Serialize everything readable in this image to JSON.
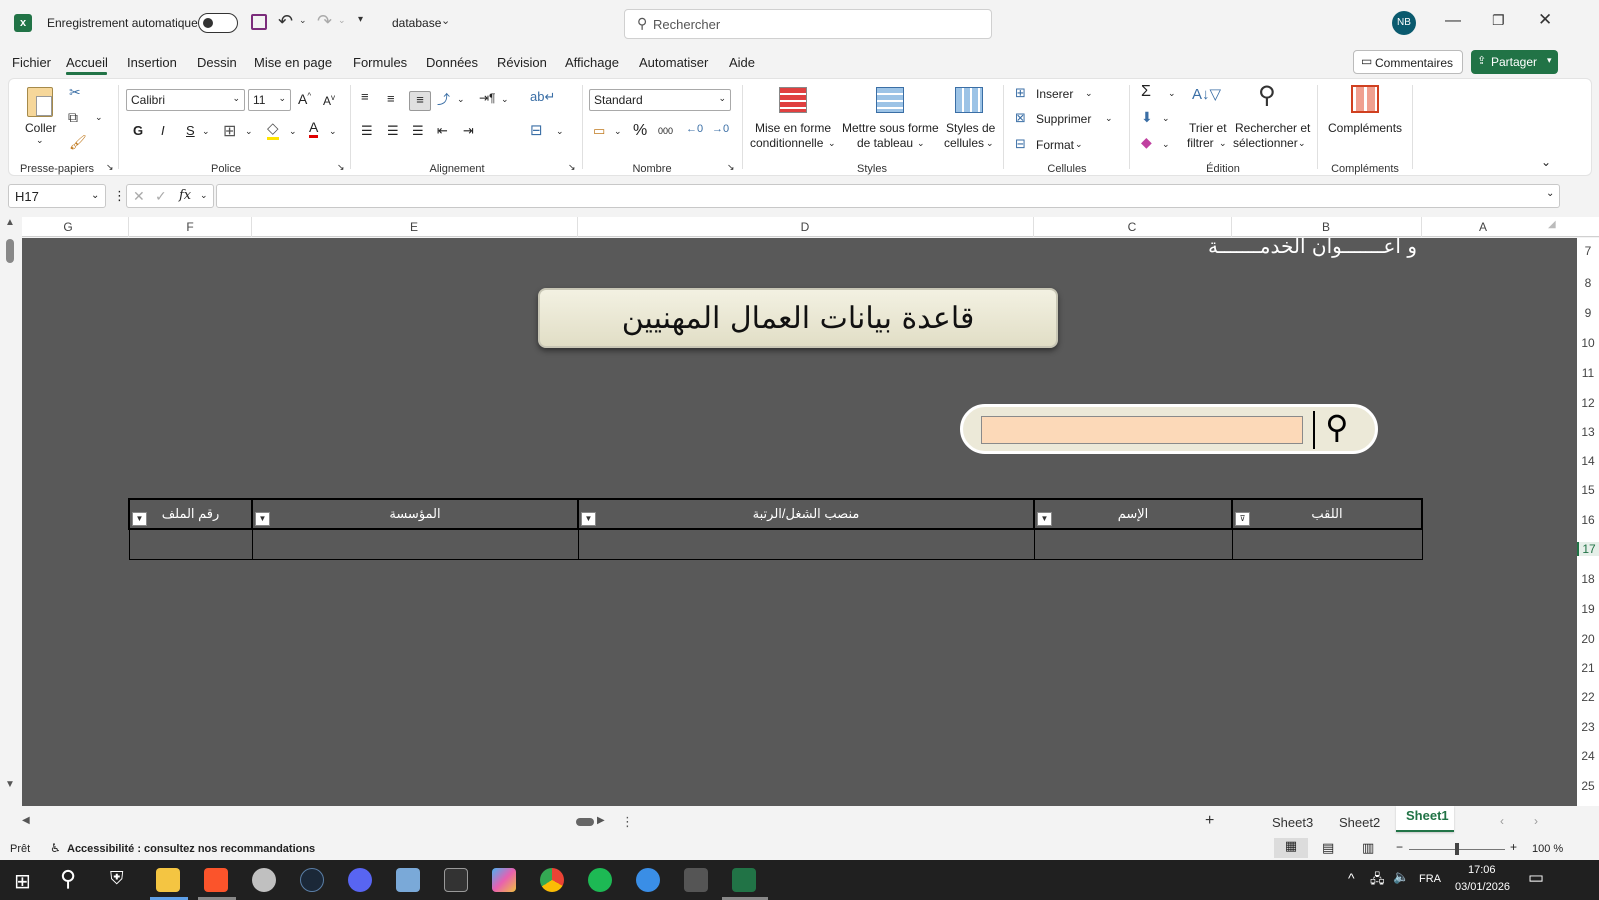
{
  "titlebar": {
    "autosave_label": "Enregistrement automatique",
    "filename": "database",
    "search_placeholder": "Rechercher",
    "user_initials": "NB",
    "autosave_on": false
  },
  "menus": [
    "Fichier",
    "Accueil",
    "Insertion",
    "Dessin",
    "Mise en page",
    "Formules",
    "Données",
    "Révision",
    "Affichage",
    "Automatiser",
    "Aide"
  ],
  "active_menu": "Accueil",
  "header_buttons": {
    "comments": "Commentaires",
    "share": "Partager"
  },
  "ribbon": {
    "clipboard": {
      "paste": "Coller",
      "label": "Presse-papiers"
    },
    "font": {
      "name": "Calibri",
      "size": "11",
      "bold": "G",
      "italic": "I",
      "underline": "S",
      "label": "Police"
    },
    "alignment": {
      "label": "Alignement"
    },
    "number": {
      "format": "Standard",
      "percent": "%",
      "thousands": "000",
      "label": "Nombre"
    },
    "styles": {
      "conditional_1": "Mise en forme",
      "conditional_2": "conditionnelle",
      "table_1": "Mettre sous forme",
      "table_2": "de tableau",
      "cell_1": "Styles de",
      "cell_2": "cellules",
      "label": "Styles"
    },
    "cells": {
      "insert": "Inserer",
      "delete": "Supprimer",
      "format": "Format",
      "label": "Cellules"
    },
    "editing": {
      "sort_1": "Trier et",
      "sort_2": "filtrer",
      "find_1": "Rechercher et",
      "find_2": "sélectionner",
      "label": "Édition"
    },
    "addins": {
      "button": "Compléments",
      "label": "Compléments"
    }
  },
  "formula_bar": {
    "cell_ref": "H17",
    "fx": "fx",
    "value": ""
  },
  "columns": [
    {
      "label": "G"
    },
    {
      "label": "F"
    },
    {
      "label": "E"
    },
    {
      "label": "D"
    },
    {
      "label": "C"
    },
    {
      "label": "B"
    },
    {
      "label": "A"
    }
  ],
  "rows": [
    "7",
    "8",
    "9",
    "10",
    "11",
    "12",
    "13",
    "14",
    "15",
    "16",
    "17",
    "18",
    "19",
    "20",
    "21",
    "22",
    "23",
    "24",
    "25"
  ],
  "active_row": "17",
  "sheet": {
    "top_text": "و أعـــــــوان الخدمـــــــة",
    "title": "قاعدة بيانات العمال المهنيين",
    "search_value": "",
    "table_headers": [
      "رقم الملف",
      "المؤسسة",
      "منصب الشغل/الرتبة",
      "الإسم",
      "اللقب"
    ]
  },
  "sheet_tabs": [
    "Sheet3",
    "Sheet2",
    "Sheet1"
  ],
  "active_tab": "Sheet1",
  "status": {
    "ready": "Prêt",
    "accessibility": "Accessibilité : consultez nos recommandations",
    "zoom": "100 %"
  },
  "taskbar": {
    "lang": "FRA",
    "time": "17:06",
    "date": "03/01/2026"
  },
  "colors": {
    "excel_green": "#217346",
    "sheet_bg": "#595959",
    "search_fill": "#fcd9b8"
  }
}
